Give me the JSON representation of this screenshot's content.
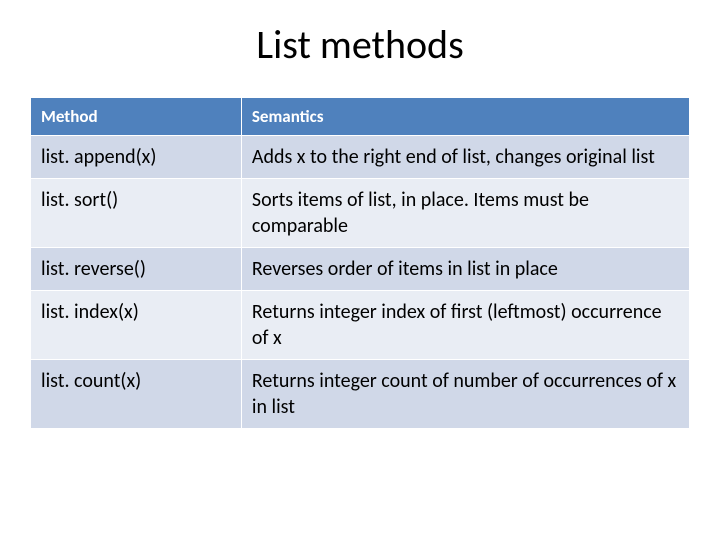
{
  "title": "List methods",
  "headers": {
    "method": "Method",
    "semantics": "Semantics"
  },
  "rows": [
    {
      "method": "list. append(x)",
      "semantics": "Adds x to the right end of list, changes original list"
    },
    {
      "method": "list. sort()",
      "semantics": "Sorts items of list, in place. Items must be comparable"
    },
    {
      "method": "list. reverse()",
      "semantics": "Reverses order of items in list in place"
    },
    {
      "method": "list. index(x)",
      "semantics": "Returns integer index of first (leftmost) occurrence of x"
    },
    {
      "method": "list. count(x)",
      "semantics": "Returns integer count of number of occurrences of x in list"
    }
  ]
}
